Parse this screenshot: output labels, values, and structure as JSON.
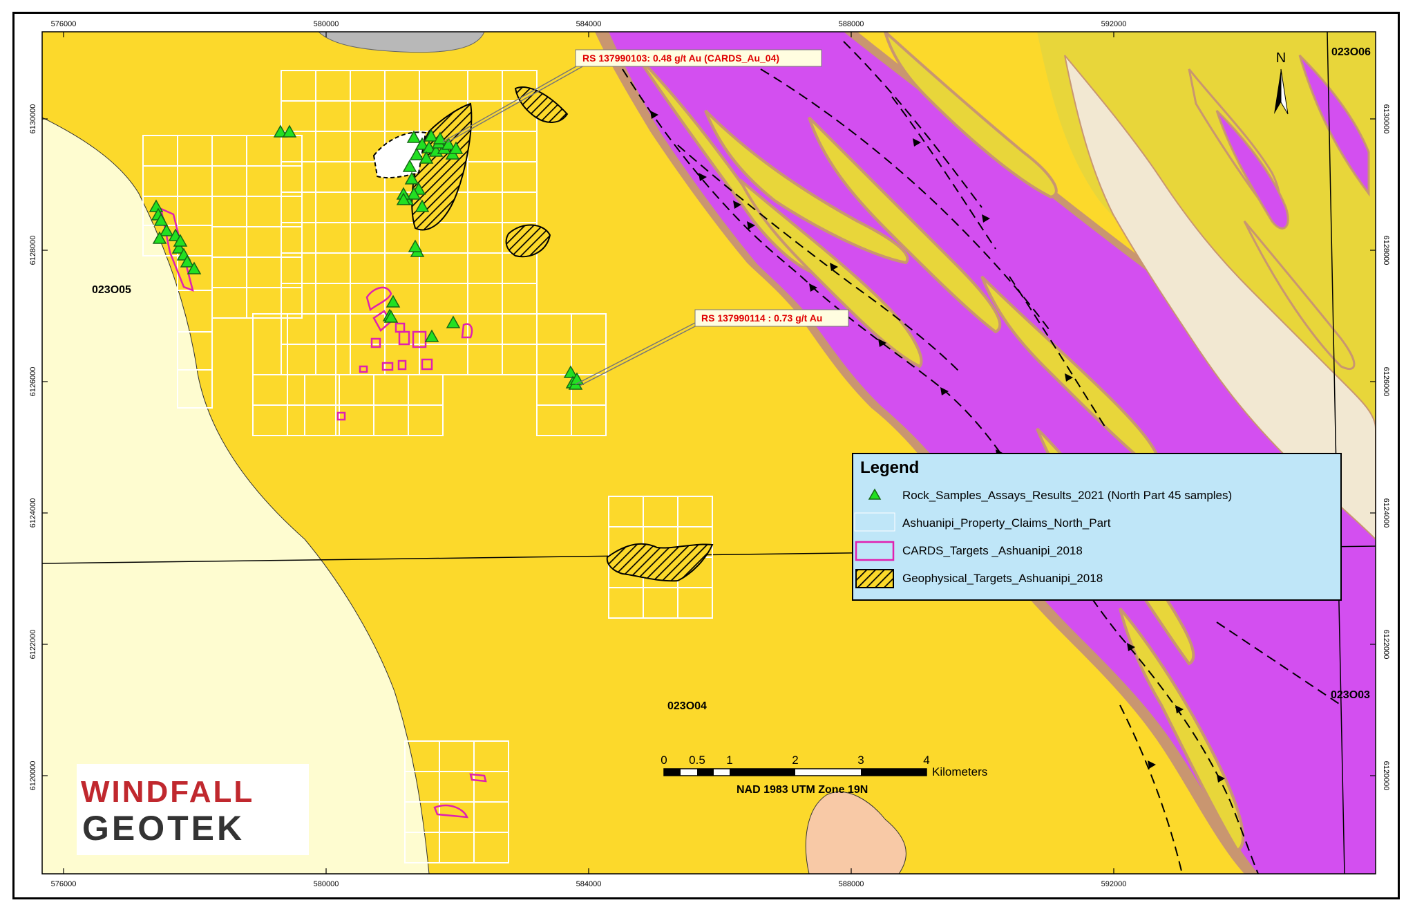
{
  "colors": {
    "yellow_unit": "#fcd92b",
    "pale_unit": "#fefcd0",
    "magenta_unit": "#d34ff0",
    "olive_unit": "#e8d63a",
    "cream_unit": "#f2e8d2",
    "brown_rim": "#c99670",
    "grey_unit": "#b8b8b8",
    "salmon_unit": "#f8c9a6",
    "claims_fill": "#bfe6f8",
    "cards_outline": "#e020b0",
    "sample_green": "#22e022",
    "callout_red": "#e00000"
  },
  "axes": {
    "x_ticks": [
      "576000",
      "580000",
      "584000",
      "588000",
      "592000"
    ],
    "y_ticks": [
      "6130000",
      "6128000",
      "6126000",
      "6124000",
      "6122000",
      "6120000"
    ]
  },
  "sheets": {
    "nw": "023O05",
    "ne": "023O06",
    "center": "023O04",
    "se": "023O03"
  },
  "callouts": [
    {
      "text": "RS 137990103: 0.48 g/t Au (CARDS_Au_04)"
    },
    {
      "text": "RS 137990114 : 0.73 g/t Au"
    }
  ],
  "north_label": "N",
  "legend": {
    "title": "Legend",
    "items": [
      {
        "symbol": "triangle",
        "label": "Rock_Samples_Assays_Results_2021 (North Part 45 samples)"
      },
      {
        "symbol": "claims",
        "label": "Ashuanipi_Property_Claims_North_Part"
      },
      {
        "symbol": "cards",
        "label": "CARDS_Targets _Ashuanipi_2018"
      },
      {
        "symbol": "hatch",
        "label": "Geophysical_Targets_Ashuanipi_2018"
      }
    ]
  },
  "scalebar": {
    "labels": [
      "0",
      "0.5",
      "1",
      "2",
      "3",
      "4"
    ],
    "unit": "Kilometers",
    "projection": "NAD 1983 UTM Zone 19N"
  },
  "logo": {
    "line1": "WINDFALL",
    "line2": "GEOTEK"
  },
  "rock_samples": {
    "count_shown": 45
  }
}
